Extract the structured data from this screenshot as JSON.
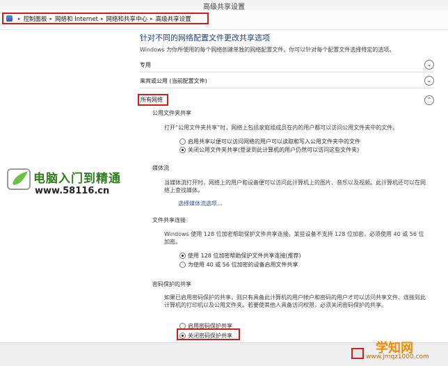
{
  "window": {
    "title": "高级共享设置"
  },
  "breadcrumb": {
    "items": [
      "控制面板",
      "网络和 Internet",
      "网络和共享中心",
      "高级共享设置"
    ]
  },
  "main": {
    "heading": "针对不同的网络配置文件更改共享选项",
    "intro": "Windows 为你所使用的每个网络创建单独的网络配置文件。你可以针对每个配置文件选择特定的选项。",
    "profiles": [
      {
        "label": "专用",
        "expanded": false
      },
      {
        "label": "来宾或公用 (当前配置文件)",
        "expanded": false
      },
      {
        "label": "所有网络",
        "expanded": true
      }
    ],
    "public_folder": {
      "heading": "公用文件夹共享",
      "desc": "打开“公用文件夹共享”时，网络上包括家庭组成员在内的用户都可以访问公用文件夹中的文件。",
      "options": [
        {
          "label": "启用共享以便可以访问网络的用户可以读取和写入公用文件夹中的文件",
          "selected": false
        },
        {
          "label": "关闭公用文件夹共享(登录到此计算机的用户仍然可以访问这些文件夹)",
          "selected": true
        }
      ]
    },
    "media": {
      "heading": "媒体流",
      "desc": "当媒体流打开时，网络上的用户和设备便可以访问此计算机上的图片、音乐以及视频。此计算机还可以在网络上查找媒体。",
      "link": "选择媒体流选项..."
    },
    "file_sharing": {
      "heading": "文件共享连接",
      "desc": "Windows 使用 128 位加密帮助保护文件共享连接。某些设备不支持 128 位加密，必须使用 40 或 56 位加密。",
      "options": [
        {
          "label": "使用 128 位加密帮助保护文件共享连接(推荐)",
          "selected": true
        },
        {
          "label": "为使用 40 或 56 位加密的设备启用文件共享",
          "selected": false
        }
      ]
    },
    "password": {
      "heading": "密码保护的共享",
      "desc": "如果已启用密码保护的共享，则只有具备此计算机的用户帐户和密码的用户才可以访问共享文件、连接到此计算机的打印机以及公用文件夹。若要使其他人具备访问权限，必须关闭密码保护的共享。",
      "options": [
        {
          "label": "启用密码保护共享",
          "selected": false
        },
        {
          "label": "关闭密码保护共享",
          "selected": true
        }
      ]
    }
  },
  "watermark": {
    "brand": "电脑入门到精通",
    "url": "www.58116.cn",
    "site": "学知网",
    "site_url": "www.jmqz1000.com"
  },
  "colors": {
    "highlight": "#d21b1b",
    "heading": "#1e3f8a",
    "link": "#2a57b5"
  }
}
